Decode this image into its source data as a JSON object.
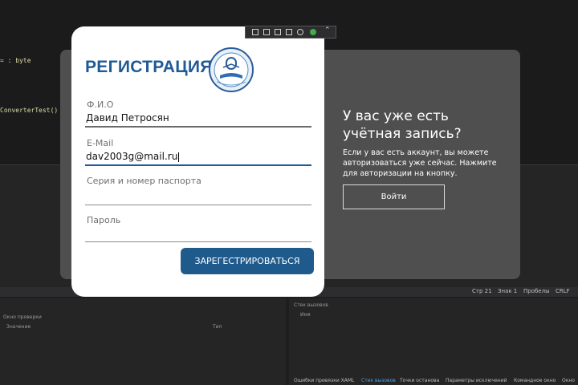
{
  "ide": {
    "code_line_1": "= : byte",
    "code_line_2": "ConverterTest()",
    "status": [
      "Стр 21",
      "Знак 1",
      "Пробелы",
      "CRLF"
    ],
    "left_panel_header": "Окно проверки",
    "left_panel_col1": "Значение",
    "left_panel_col2": "Тип",
    "right_panel_header": "Стек вызовов",
    "right_panel_col": "Имя",
    "bottom_tabs": [
      "Ошибки привязки XAML",
      "Стек вызовов",
      "Точки останова",
      "Параметры исключений",
      "Командное окно",
      "Окно"
    ]
  },
  "registration": {
    "title": "РЕГИСТРАЦИЯ",
    "fio_label": "Ф.И.О",
    "fio_value": "Давид Петросян",
    "email_label": "E-Mail",
    "email_value": "dav2003g@mail.ru",
    "passport_placeholder": "Серия и номер паспорта",
    "password_placeholder": "Пароль",
    "submit_label": "ЗАРЕГЕСТРИРОВАТЬСЯ"
  },
  "login_panel": {
    "title": "У вас уже есть учётная запись?",
    "text": "Если у вас есть аккаунт, вы можете авторизоваться уже сейчас. Нажмите для авторизации на кнопку.",
    "button_label": "Войти"
  },
  "colors": {
    "brand_blue": "#1f5a96",
    "button_blue": "#1f5a8c",
    "card_dark": "#4f4f4f"
  }
}
